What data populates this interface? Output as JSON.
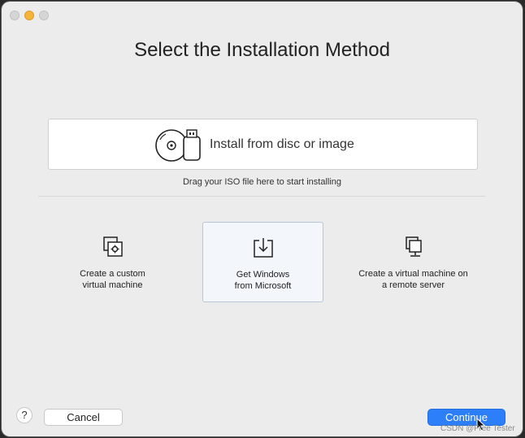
{
  "window": {
    "title": "Select the Installation Method"
  },
  "disc_option": {
    "label": "Install from disc or image",
    "hint": "Drag your ISO file here to start installing",
    "icon": "disc-usb-icon"
  },
  "options": [
    {
      "line1": "Create a custom",
      "line2": "virtual machine",
      "icon": "custom-vm-icon",
      "selected": false
    },
    {
      "line1": "Get Windows",
      "line2": "from Microsoft",
      "icon": "download-icon",
      "selected": true
    },
    {
      "line1": "Create a virtual machine on",
      "line2": "a remote server",
      "icon": "remote-server-icon",
      "selected": false
    }
  ],
  "footer": {
    "help_label": "?",
    "cancel_label": "Cancel",
    "continue_label": "Continue"
  },
  "watermark": "CSDN @Free Tester",
  "colors": {
    "accent": "#2d7ff9",
    "window_bg": "#ececec",
    "selected_bg": "#f3f6fb"
  }
}
